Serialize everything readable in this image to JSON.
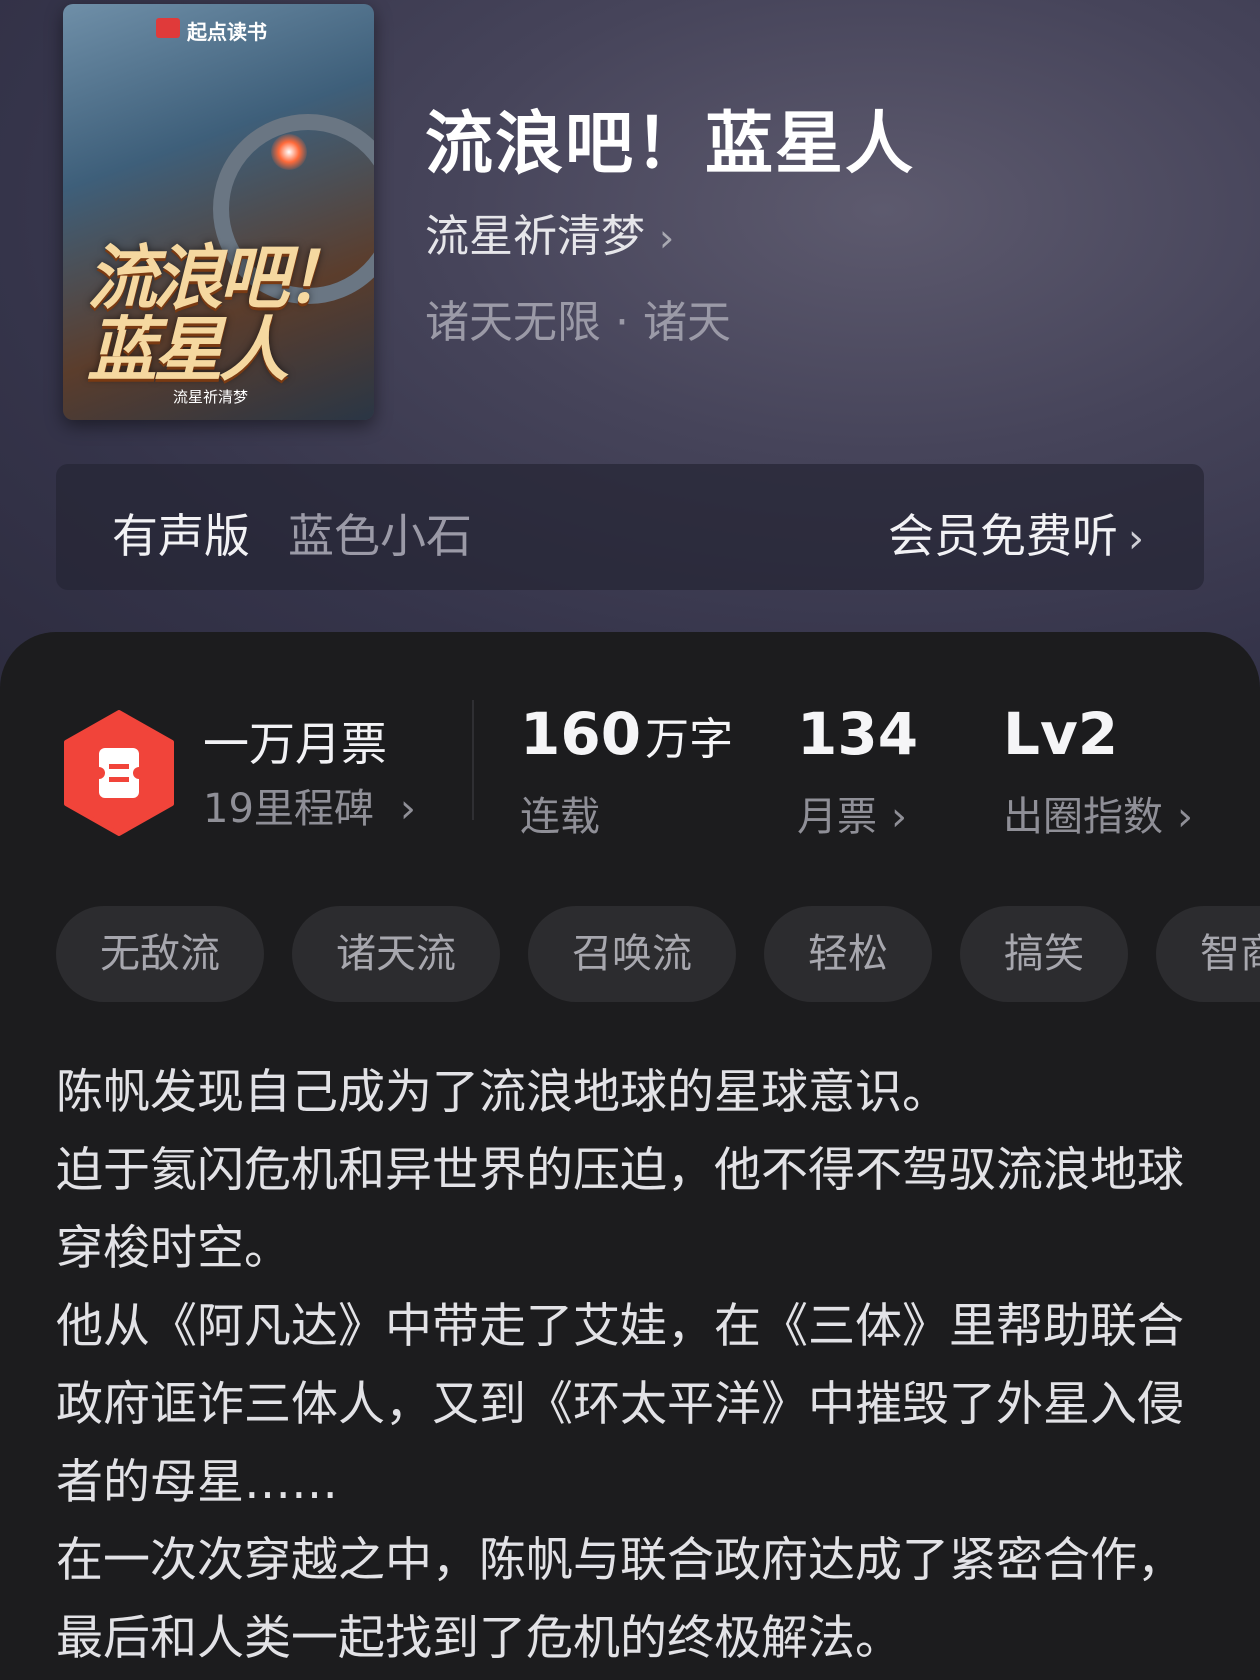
{
  "book": {
    "cover": {
      "brand": "起点读书",
      "title": "流浪吧！蓝星人",
      "author": "流星祈清梦"
    },
    "title": "流浪吧！蓝星人",
    "author": "流星祈清梦",
    "genre": "诸天无限 · 诸天"
  },
  "audio": {
    "label": "有声版",
    "narrator": "蓝色小石",
    "cta": "会员免费听"
  },
  "stats": {
    "ticket_main": "一万月票",
    "ticket_sub": "19里程碑",
    "words": "160",
    "words_unit": "万字",
    "words_label": "连载",
    "monthly_votes": "134",
    "monthly_votes_label": "月票",
    "level": "Lv2",
    "level_label": "出圈指数"
  },
  "tags": [
    "无敌流",
    "诸天流",
    "召唤流",
    "轻松",
    "搞笑",
    "智商"
  ],
  "description": [
    "陈帆发现自己成为了流浪地球的星球意识。",
    "迫于氦闪危机和异世界的压迫，他不得不驾驭流浪地球穿梭时空。",
    "他从《阿凡达》中带走了艾娃，在《三体》里帮助联合政府诓诈三体人，又到《环太平洋》中摧毁了外星入侵者的母星……",
    "在一次次穿越之中，陈帆与联合政府达成了紧密合作，最后和人类一起找到了危机的终极解法。"
  ],
  "colors": {
    "header_bg": "#46445a",
    "content_bg": "#1c1c1e",
    "ticket_icon": "#f1443a",
    "tag_bg": "#2c2c2f"
  },
  "icons": {
    "ticket": "ticket-icon",
    "chevron": "chevron-right-icon"
  }
}
